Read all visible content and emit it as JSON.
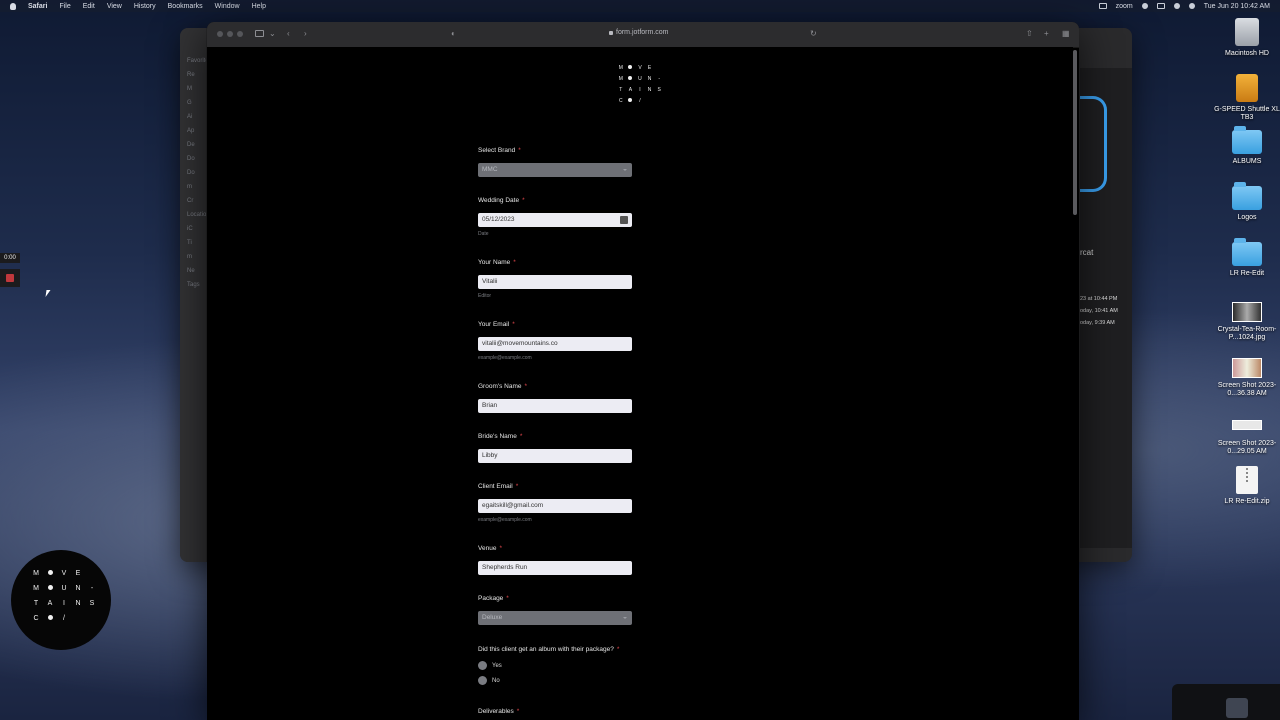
{
  "menubar": {
    "items": [
      "Safari",
      "File",
      "Edit",
      "View",
      "History",
      "Bookmarks",
      "Window",
      "Help"
    ],
    "app_name": "zoom",
    "clock": "Tue Jun 20  10:42 AM"
  },
  "desktop": {
    "icons": [
      {
        "label": "Macintosh HD",
        "kind": "hdd-icon"
      },
      {
        "label": "G-SPEED Shuttle XL TB3",
        "kind": "drive-icon"
      },
      {
        "label": "ALBUMS",
        "kind": "folder-icon"
      },
      {
        "label": "Logos",
        "kind": "folder-icon"
      },
      {
        "label": "LR Re-Edit",
        "kind": "folder-icon"
      },
      {
        "label": "Crystal-Tea-Room-P...1024.jpg",
        "kind": "image-icon"
      },
      {
        "label": "Screen Shot 2023-0...36.38 AM",
        "kind": "image-icon"
      },
      {
        "label": "Screen Shot 2023-0...29.05 AM",
        "kind": "image-icon"
      },
      {
        "label": "LR Re-Edit.zip",
        "kind": "zip-icon"
      }
    ]
  },
  "recorder": {
    "time": "0:00"
  },
  "background_window": {
    "sidebar": [
      "Favorites",
      "Re",
      "M",
      "G",
      "Ai",
      "Ap",
      "De",
      "Do",
      "Do",
      "m",
      "Cr",
      "Locations",
      "iC",
      "Ti",
      "m",
      "Ne",
      "Tags"
    ],
    "name": "rcat",
    "dates": [
      "23 at 10:44 PM",
      "oday, 10:41 AM",
      "oday, 9:39 AM"
    ]
  },
  "logo": {
    "rows": [
      [
        "M",
        "•",
        "V",
        "E",
        ""
      ],
      [
        "M",
        "•",
        "U",
        "N",
        "-"
      ],
      [
        "T",
        "A",
        "I",
        "N",
        "S"
      ],
      [
        "C",
        "•",
        "/",
        "",
        ""
      ]
    ]
  },
  "browser": {
    "url": "form.jotform.com"
  },
  "form": {
    "fields": [
      {
        "label": "Select Brand",
        "value": "MMC",
        "type": "select"
      },
      {
        "label": "Wedding Date",
        "value": "05/12/2023",
        "type": "date",
        "sublabel": "Date"
      },
      {
        "label": "Your Name",
        "value": "Vitalii",
        "type": "text",
        "sublabel": "Editor"
      },
      {
        "label": "Your Email",
        "value": "vitalii@movemountains.co",
        "type": "text",
        "sublabel": "example@example.com"
      },
      {
        "label": "Groom's Name",
        "value": "Brian",
        "type": "text"
      },
      {
        "label": "Bride's Name",
        "value": "Libby",
        "type": "text"
      },
      {
        "label": "Client Email",
        "value": "egaitskill@gmail.com",
        "type": "text",
        "sublabel": "example@example.com"
      },
      {
        "label": "Venue",
        "value": "Shepherds Run",
        "type": "text"
      },
      {
        "label": "Package",
        "value": "Deluxe",
        "type": "select"
      }
    ],
    "album_question": {
      "label": "Did this client get an album with their package?",
      "options": [
        "Yes",
        "No"
      ]
    },
    "deliverables_label": "Deliverables",
    "required_mark": "*"
  }
}
